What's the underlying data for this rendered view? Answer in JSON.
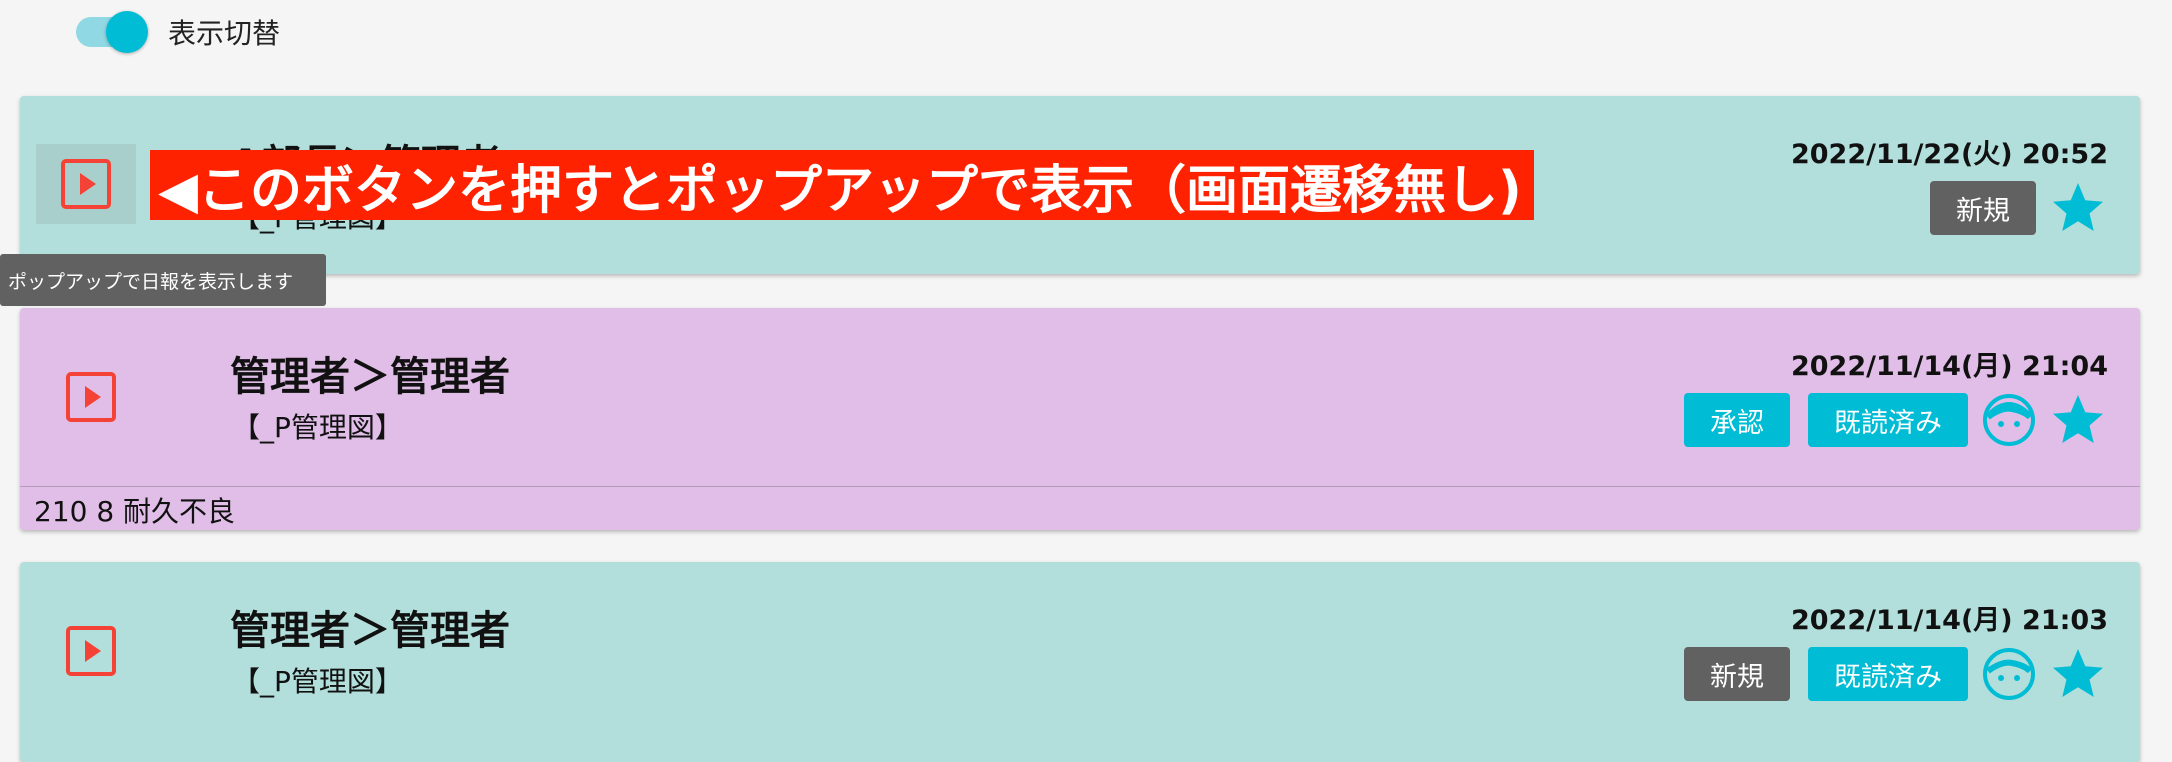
{
  "toggle": {
    "label": "表示切替",
    "on": true
  },
  "tooltip": "ポップアップで日報を表示します",
  "annotation": "◀このボタンを押すとポップアップで表示（画面遷移無し)",
  "cards": [
    {
      "title": "A部長＞管理者",
      "subtitle": "【_P管理図】",
      "date": "2022/11/22(火) 20:52",
      "status_button": "新規",
      "read_button": "",
      "note": ""
    },
    {
      "title": "管理者＞管理者",
      "subtitle": "【_P管理図】",
      "date": "2022/11/14(月) 21:04",
      "status_button": "承認",
      "read_button": "既読済み",
      "note": "210 8 耐久不良"
    },
    {
      "title": "管理者＞管理者",
      "subtitle": "【_P管理図】",
      "date": "2022/11/14(月) 21:03",
      "status_button": "新規",
      "read_button": "既読済み",
      "note": ""
    }
  ],
  "colors": {
    "teal_card": "#b2dfdb",
    "purple_card": "#e1bee7",
    "accent": "#00bcd4",
    "play_icon": "#f44336",
    "annotation_bg": "#ff2200"
  }
}
